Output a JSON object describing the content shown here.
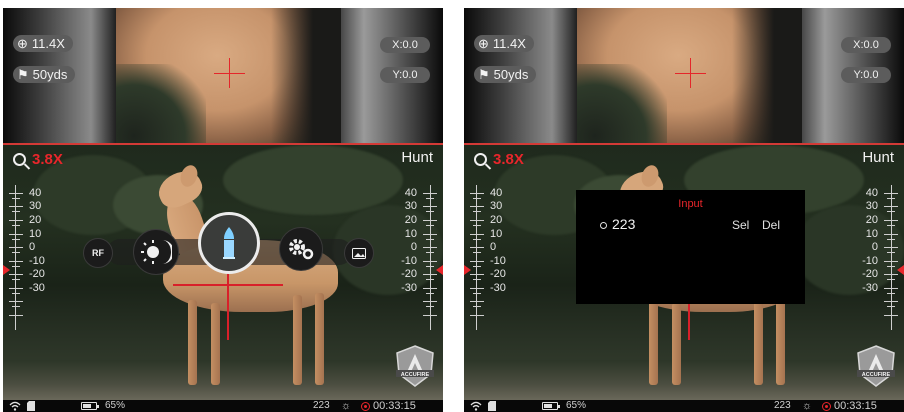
{
  "zoom_window": {
    "magnification": "11.4X",
    "distance": "50yds",
    "x_offset": "X:0.0",
    "y_offset": "Y:0.0"
  },
  "main_view": {
    "zoom": "3.8X",
    "mode": "Hunt",
    "scale_labels": [
      "40",
      "30",
      "20",
      "10",
      "0",
      "-10",
      "-20",
      "-30"
    ]
  },
  "menu": {
    "items": [
      {
        "label": "RF",
        "icon": "rangefinder-icon"
      },
      {
        "icon": "brightness-contrast-icon"
      },
      {
        "icon": "bullet-icon",
        "selected": true
      },
      {
        "icon": "settings-gears-icon"
      },
      {
        "icon": "picture-icon"
      }
    ]
  },
  "dialog": {
    "title": "Input",
    "value": "223",
    "select_label": "Sel",
    "delete_label": "Del"
  },
  "status": {
    "battery": "65%",
    "profile": "223",
    "time": "00:33:15"
  },
  "logo": {
    "text": "ACCUFIRE"
  },
  "colors": {
    "accent": "#e8262b",
    "text": "#f2f2f2",
    "pill": "#5c5c5c"
  }
}
